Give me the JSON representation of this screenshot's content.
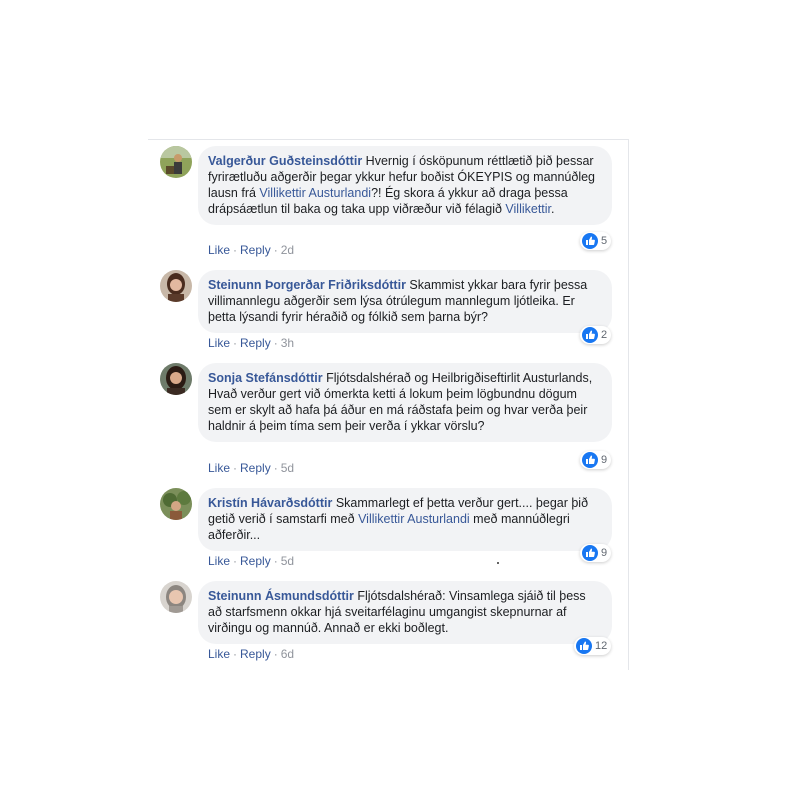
{
  "comments": [
    {
      "author": "Valgerður Guðsteinsdóttir",
      "text_parts": [
        "Hvernig í ósköpunum réttlætið þið þessar fyrirætluðu aðgerðir þegar ykkur hefur boðist ÓKEYPIS og mannúðleg lausn frá ",
        "?! Ég skora á ykkur að draga þessa drápsáætlun til baka og taka upp viðræður við félagið ",
        "."
      ],
      "tags": [
        "Villikettir Austurlandi",
        "Villikettir"
      ],
      "like_label": "Like",
      "reply_label": "Reply",
      "separator": "·",
      "time": "2d",
      "reaction_count": "5",
      "reaction_icon": "like-icon"
    },
    {
      "author": "Steinunn Þorgerðar Friðriksdóttir",
      "text": "Skammist ykkar bara fyrir þessa villimannlegu aðgerðir sem lýsa ótrúlegum mannlegum ljótleika. Er þetta lýsandi fyrir héraðið og fólkið sem þarna býr?",
      "like_label": "Like",
      "reply_label": "Reply",
      "separator": "·",
      "time": "3h",
      "reaction_count": "2",
      "reaction_icon": "like-icon"
    },
    {
      "author": "Sonja Stefánsdóttir",
      "text_line1": "Fljótsdalshérað og Heilbrigðiseftirlit Austurlands,",
      "text_line2": "Hvað verður gert við ómerkta ketti á lokum þeim lögbundnu dögum sem er skylt að hafa þá áður en má ráðstafa þeim og hvar verða þeir haldnir á þeim tíma sem þeir verða í ykkar vörslu?",
      "like_label": "Like",
      "reply_label": "Reply",
      "separator": "·",
      "time": "5d",
      "reaction_count": "9",
      "reaction_icon": "like-icon"
    },
    {
      "author": "Kristín Hávarðsdóttir",
      "text_parts": [
        "Skammarlegt ef þetta verður gert.... þegar þið getið verið í samstarfi með ",
        " með mannúðlegri aðferðir..."
      ],
      "tag": "Villikettir Austurlandi",
      "like_label": "Like",
      "reply_label": "Reply",
      "separator": "·",
      "time": "5d",
      "reaction_count": "9",
      "reaction_icon": "like-icon"
    },
    {
      "author": "Steinunn Ásmundsdóttir",
      "text": "Fljótsdalshérað: Vinsamlega sjáið til þess að starfsmenn okkar hjá sveitarfélaginu umgangist skepnurnar af virðingu og mannúð. Annað er ekki boðlegt.",
      "like_label": "Like",
      "reply_label": "Reply",
      "separator": "·",
      "time": "6d",
      "reaction_count": "12",
      "reaction_icon": "like-icon"
    }
  ],
  "colors": {
    "name_link": "#385898",
    "bubble_bg": "#f2f3f5",
    "like_blue": "#1877f2",
    "meta_gray": "#90949c"
  }
}
